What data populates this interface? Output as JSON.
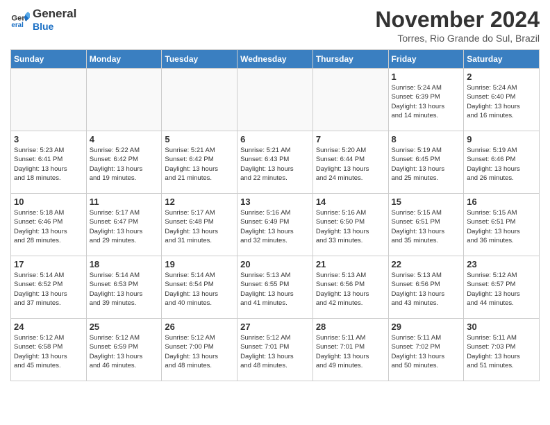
{
  "logo": {
    "line1": "General",
    "line2": "Blue"
  },
  "title": "November 2024",
  "location": "Torres, Rio Grande do Sul, Brazil",
  "days_of_week": [
    "Sunday",
    "Monday",
    "Tuesday",
    "Wednesday",
    "Thursday",
    "Friday",
    "Saturday"
  ],
  "weeks": [
    [
      {
        "day": "",
        "info": ""
      },
      {
        "day": "",
        "info": ""
      },
      {
        "day": "",
        "info": ""
      },
      {
        "day": "",
        "info": ""
      },
      {
        "day": "",
        "info": ""
      },
      {
        "day": "1",
        "info": "Sunrise: 5:24 AM\nSunset: 6:39 PM\nDaylight: 13 hours\nand 14 minutes."
      },
      {
        "day": "2",
        "info": "Sunrise: 5:24 AM\nSunset: 6:40 PM\nDaylight: 13 hours\nand 16 minutes."
      }
    ],
    [
      {
        "day": "3",
        "info": "Sunrise: 5:23 AM\nSunset: 6:41 PM\nDaylight: 13 hours\nand 18 minutes."
      },
      {
        "day": "4",
        "info": "Sunrise: 5:22 AM\nSunset: 6:42 PM\nDaylight: 13 hours\nand 19 minutes."
      },
      {
        "day": "5",
        "info": "Sunrise: 5:21 AM\nSunset: 6:42 PM\nDaylight: 13 hours\nand 21 minutes."
      },
      {
        "day": "6",
        "info": "Sunrise: 5:21 AM\nSunset: 6:43 PM\nDaylight: 13 hours\nand 22 minutes."
      },
      {
        "day": "7",
        "info": "Sunrise: 5:20 AM\nSunset: 6:44 PM\nDaylight: 13 hours\nand 24 minutes."
      },
      {
        "day": "8",
        "info": "Sunrise: 5:19 AM\nSunset: 6:45 PM\nDaylight: 13 hours\nand 25 minutes."
      },
      {
        "day": "9",
        "info": "Sunrise: 5:19 AM\nSunset: 6:46 PM\nDaylight: 13 hours\nand 26 minutes."
      }
    ],
    [
      {
        "day": "10",
        "info": "Sunrise: 5:18 AM\nSunset: 6:46 PM\nDaylight: 13 hours\nand 28 minutes."
      },
      {
        "day": "11",
        "info": "Sunrise: 5:17 AM\nSunset: 6:47 PM\nDaylight: 13 hours\nand 29 minutes."
      },
      {
        "day": "12",
        "info": "Sunrise: 5:17 AM\nSunset: 6:48 PM\nDaylight: 13 hours\nand 31 minutes."
      },
      {
        "day": "13",
        "info": "Sunrise: 5:16 AM\nSunset: 6:49 PM\nDaylight: 13 hours\nand 32 minutes."
      },
      {
        "day": "14",
        "info": "Sunrise: 5:16 AM\nSunset: 6:50 PM\nDaylight: 13 hours\nand 33 minutes."
      },
      {
        "day": "15",
        "info": "Sunrise: 5:15 AM\nSunset: 6:51 PM\nDaylight: 13 hours\nand 35 minutes."
      },
      {
        "day": "16",
        "info": "Sunrise: 5:15 AM\nSunset: 6:51 PM\nDaylight: 13 hours\nand 36 minutes."
      }
    ],
    [
      {
        "day": "17",
        "info": "Sunrise: 5:14 AM\nSunset: 6:52 PM\nDaylight: 13 hours\nand 37 minutes."
      },
      {
        "day": "18",
        "info": "Sunrise: 5:14 AM\nSunset: 6:53 PM\nDaylight: 13 hours\nand 39 minutes."
      },
      {
        "day": "19",
        "info": "Sunrise: 5:14 AM\nSunset: 6:54 PM\nDaylight: 13 hours\nand 40 minutes."
      },
      {
        "day": "20",
        "info": "Sunrise: 5:13 AM\nSunset: 6:55 PM\nDaylight: 13 hours\nand 41 minutes."
      },
      {
        "day": "21",
        "info": "Sunrise: 5:13 AM\nSunset: 6:56 PM\nDaylight: 13 hours\nand 42 minutes."
      },
      {
        "day": "22",
        "info": "Sunrise: 5:13 AM\nSunset: 6:56 PM\nDaylight: 13 hours\nand 43 minutes."
      },
      {
        "day": "23",
        "info": "Sunrise: 5:12 AM\nSunset: 6:57 PM\nDaylight: 13 hours\nand 44 minutes."
      }
    ],
    [
      {
        "day": "24",
        "info": "Sunrise: 5:12 AM\nSunset: 6:58 PM\nDaylight: 13 hours\nand 45 minutes."
      },
      {
        "day": "25",
        "info": "Sunrise: 5:12 AM\nSunset: 6:59 PM\nDaylight: 13 hours\nand 46 minutes."
      },
      {
        "day": "26",
        "info": "Sunrise: 5:12 AM\nSunset: 7:00 PM\nDaylight: 13 hours\nand 48 minutes."
      },
      {
        "day": "27",
        "info": "Sunrise: 5:12 AM\nSunset: 7:01 PM\nDaylight: 13 hours\nand 48 minutes."
      },
      {
        "day": "28",
        "info": "Sunrise: 5:11 AM\nSunset: 7:01 PM\nDaylight: 13 hours\nand 49 minutes."
      },
      {
        "day": "29",
        "info": "Sunrise: 5:11 AM\nSunset: 7:02 PM\nDaylight: 13 hours\nand 50 minutes."
      },
      {
        "day": "30",
        "info": "Sunrise: 5:11 AM\nSunset: 7:03 PM\nDaylight: 13 hours\nand 51 minutes."
      }
    ]
  ]
}
